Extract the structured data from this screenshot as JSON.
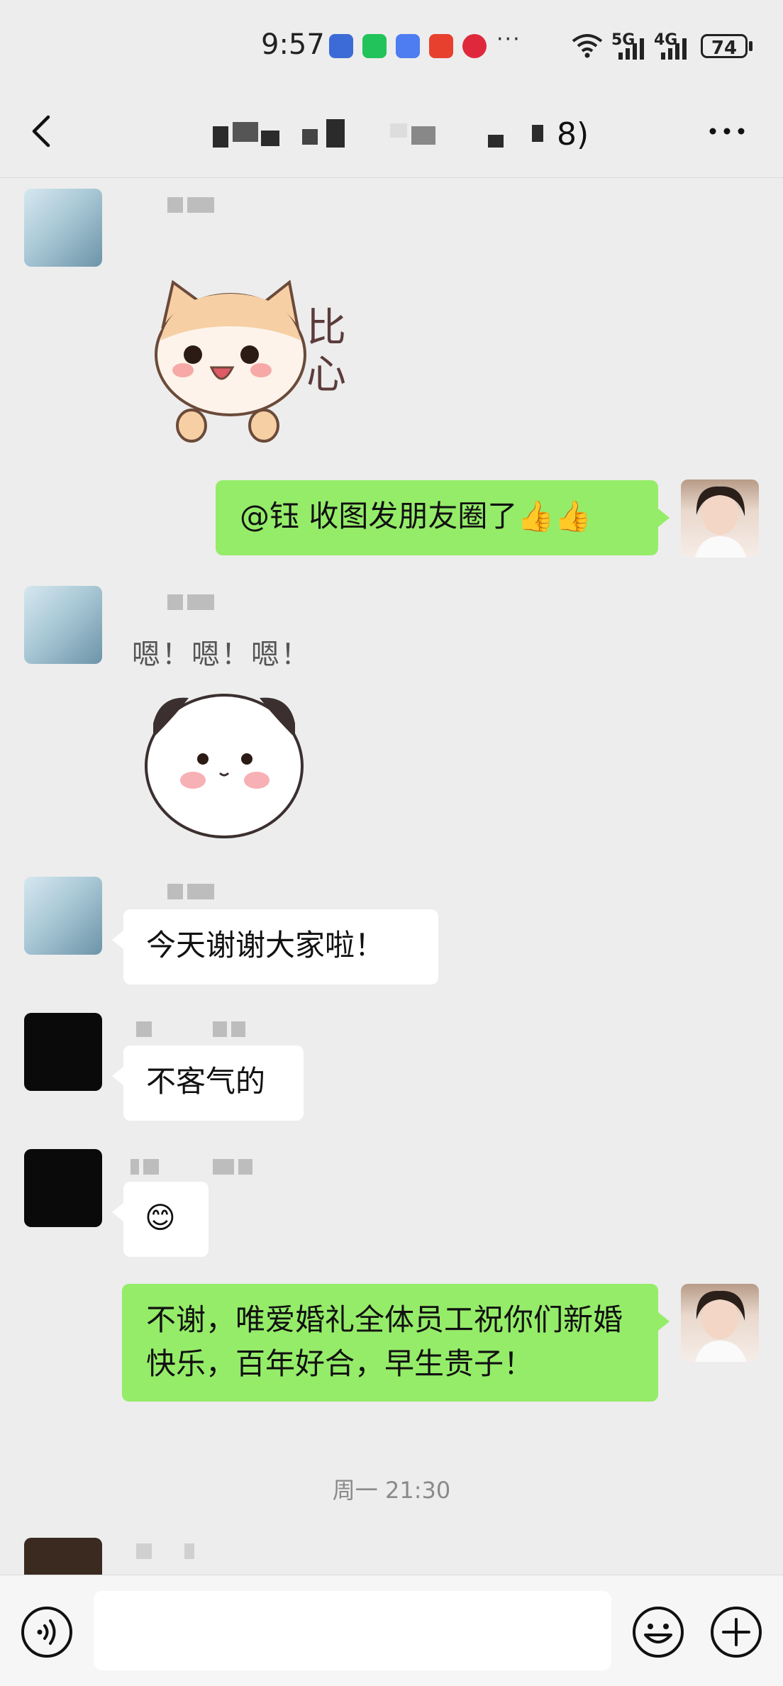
{
  "status_bar": {
    "time": "9:57",
    "more": "···",
    "signal_5g": "5G",
    "signal_4g": "4G",
    "battery": "74"
  },
  "header": {
    "title_visible_suffix": "8)"
  },
  "messages": {
    "m1_sticker_text": "比\n心",
    "m2_text": "@钰  收图发朋友圈了👍👍",
    "m3_sticker_text": "嗯！嗯！嗯！",
    "m4_text": "今天谢谢大家啦！",
    "m5_text": "不客气的",
    "m6_text": "😊",
    "m7_text": "不谢，唯爱婚礼全体员工祝你们新婚快乐，百年好合，早生贵子！"
  },
  "timestamp": "周一 21:30",
  "input": {
    "value": ""
  },
  "colors": {
    "background": "#ededed",
    "self_bubble": "#95ec69",
    "other_bubble": "#ffffff"
  }
}
